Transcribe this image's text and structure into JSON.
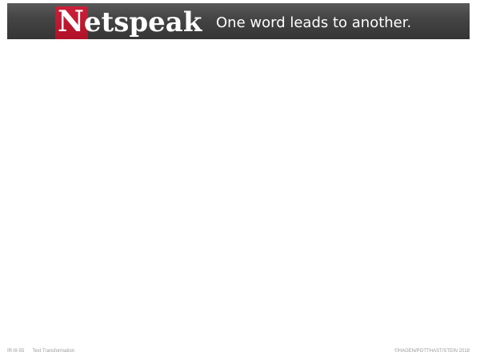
{
  "header": {
    "logo_first_letter": "N",
    "logo_rest": "etspeak",
    "tagline": "One word leads to another."
  },
  "footer": {
    "slide_number": "IR:III-55",
    "section": "Text Transformation",
    "copyright": "©HAGEN/POTTHAST/STEIN 2018"
  },
  "colors": {
    "header_background": "#454545",
    "logo_accent": "#c0172f",
    "footer_text": "#9a9a9a"
  }
}
